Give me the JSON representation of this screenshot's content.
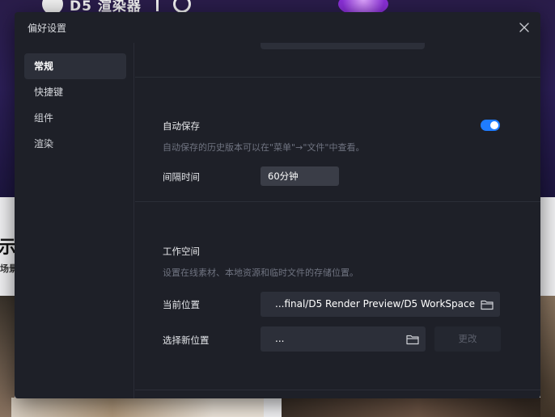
{
  "background": {
    "logo_text": "D5 渲染器",
    "heading": "示",
    "subheading": "场景"
  },
  "dialog": {
    "title": "偏好设置",
    "close_icon": "close-icon"
  },
  "sidebar": {
    "items": [
      {
        "label": "常规",
        "active": true
      },
      {
        "label": "快捷键",
        "active": false
      },
      {
        "label": "组件",
        "active": false
      },
      {
        "label": "渲染",
        "active": false
      }
    ]
  },
  "autosave": {
    "label": "自动保存",
    "description": "自动保存的历史版本可以在\"菜单\"→\"文件\"中查看。",
    "enabled": true,
    "interval_label": "间隔时间",
    "interval_value": "60分钟"
  },
  "workspace": {
    "title": "工作空间",
    "description": "设置在线素材、本地资源和临时文件的存储位置。",
    "current_label": "当前位置",
    "current_path": "...final/D5 Render Preview/D5 WorkSpace",
    "new_label": "选择新位置",
    "new_path": "...",
    "change_button": "更改",
    "folder_icon": "folder-icon"
  },
  "colors": {
    "accent": "#1f7cff",
    "dialog_bg": "#1e2028",
    "field_bg": "#2c2f39"
  }
}
